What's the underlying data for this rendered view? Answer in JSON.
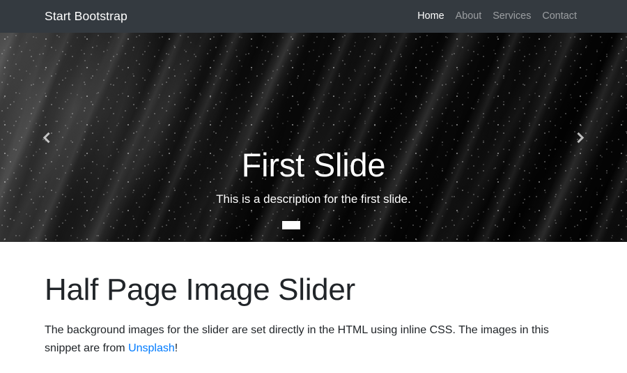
{
  "navbar": {
    "brand": "Start Bootstrap",
    "background_color": "#343a40",
    "links": [
      {
        "label": "Home",
        "active": true
      },
      {
        "label": "About",
        "active": false
      },
      {
        "label": "Services",
        "active": false
      },
      {
        "label": "Contact",
        "active": false
      }
    ]
  },
  "carousel": {
    "slide": {
      "title": "First Slide",
      "description": "This is a description for the first slide."
    },
    "prev_icon": "chevron-left-icon",
    "next_icon": "chevron-right-icon",
    "indicators": [
      {
        "active": true
      },
      {
        "active": false
      },
      {
        "active": false
      }
    ]
  },
  "content": {
    "heading": "Half Page Image Slider",
    "paragraph_before": "The background images for the slider are set directly in the HTML using inline CSS. The images in this snippet are from ",
    "link_text": "Unsplash",
    "paragraph_after": "!",
    "link_color": "#007bff"
  }
}
